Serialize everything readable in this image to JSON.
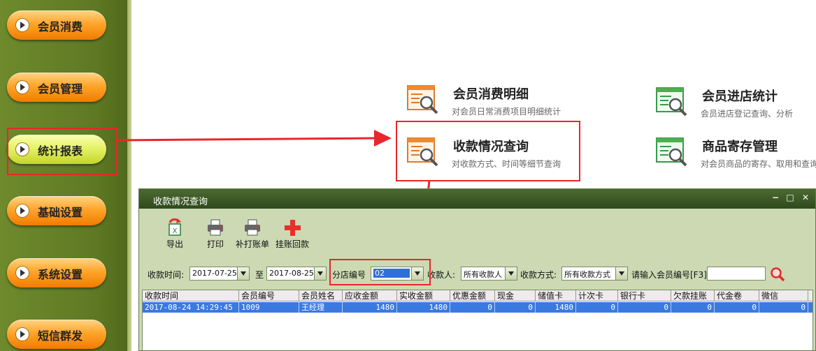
{
  "sidebar": {
    "items": [
      {
        "label": "会员消费"
      },
      {
        "label": "会员管理"
      },
      {
        "label": "统计报表"
      },
      {
        "label": "基础设置"
      },
      {
        "label": "系统设置"
      },
      {
        "label": "短信群发"
      }
    ]
  },
  "features": [
    {
      "title": "会员消费明细",
      "desc": "对会员日常消费项目明细统计"
    },
    {
      "title": "会员进店统计",
      "desc": "会员进店登记查询、分析"
    },
    {
      "title": "收款情况查询",
      "desc": "对收款方式、时间等细节查询"
    },
    {
      "title": "商品寄存管理",
      "desc": "对会员商品的寄存、取用和查询"
    }
  ],
  "dialog": {
    "title": "收款情况查询",
    "controls": {
      "minimize": "−",
      "maximize": "□",
      "close": "✕"
    },
    "toolbar": {
      "export": "导出",
      "print": "打印",
      "reprint": "补打账单",
      "repay": "挂账回款"
    },
    "filters": {
      "time_label": "收款时间:",
      "date_from": "2017-07-25",
      "to_label": "至",
      "date_to": "2017-08-25",
      "store_label": "分店编号",
      "store_value": "02",
      "payee_label": "收款人:",
      "payee_value": "所有收款人",
      "method_label": "收款方式:",
      "method_value": "所有收款方式",
      "member_label": "请输入会员编号[F3]",
      "member_value": ""
    },
    "grid": {
      "columns": [
        "收款时间",
        "会员编号",
        "会员姓名",
        "应收金额",
        "实收金额",
        "优惠金额",
        "现金",
        "储值卡",
        "计次卡",
        "银行卡",
        "欠款挂账",
        "代金卷",
        "微信"
      ],
      "rows": [
        [
          "2017-08-24 14:29:45",
          "1009",
          "王经理",
          "1480",
          "1480",
          "0",
          "0",
          "1480",
          "0",
          "0",
          "0",
          "0",
          "0"
        ]
      ]
    }
  },
  "colors": {
    "sidebar": "#5f7a24",
    "nav_button": "#ffa52b",
    "nav_active": "#e6f26a",
    "highlight_box": "#e8262c",
    "dialog_bg": "#ccd9b3",
    "selected_row": "#3a7ae0"
  }
}
